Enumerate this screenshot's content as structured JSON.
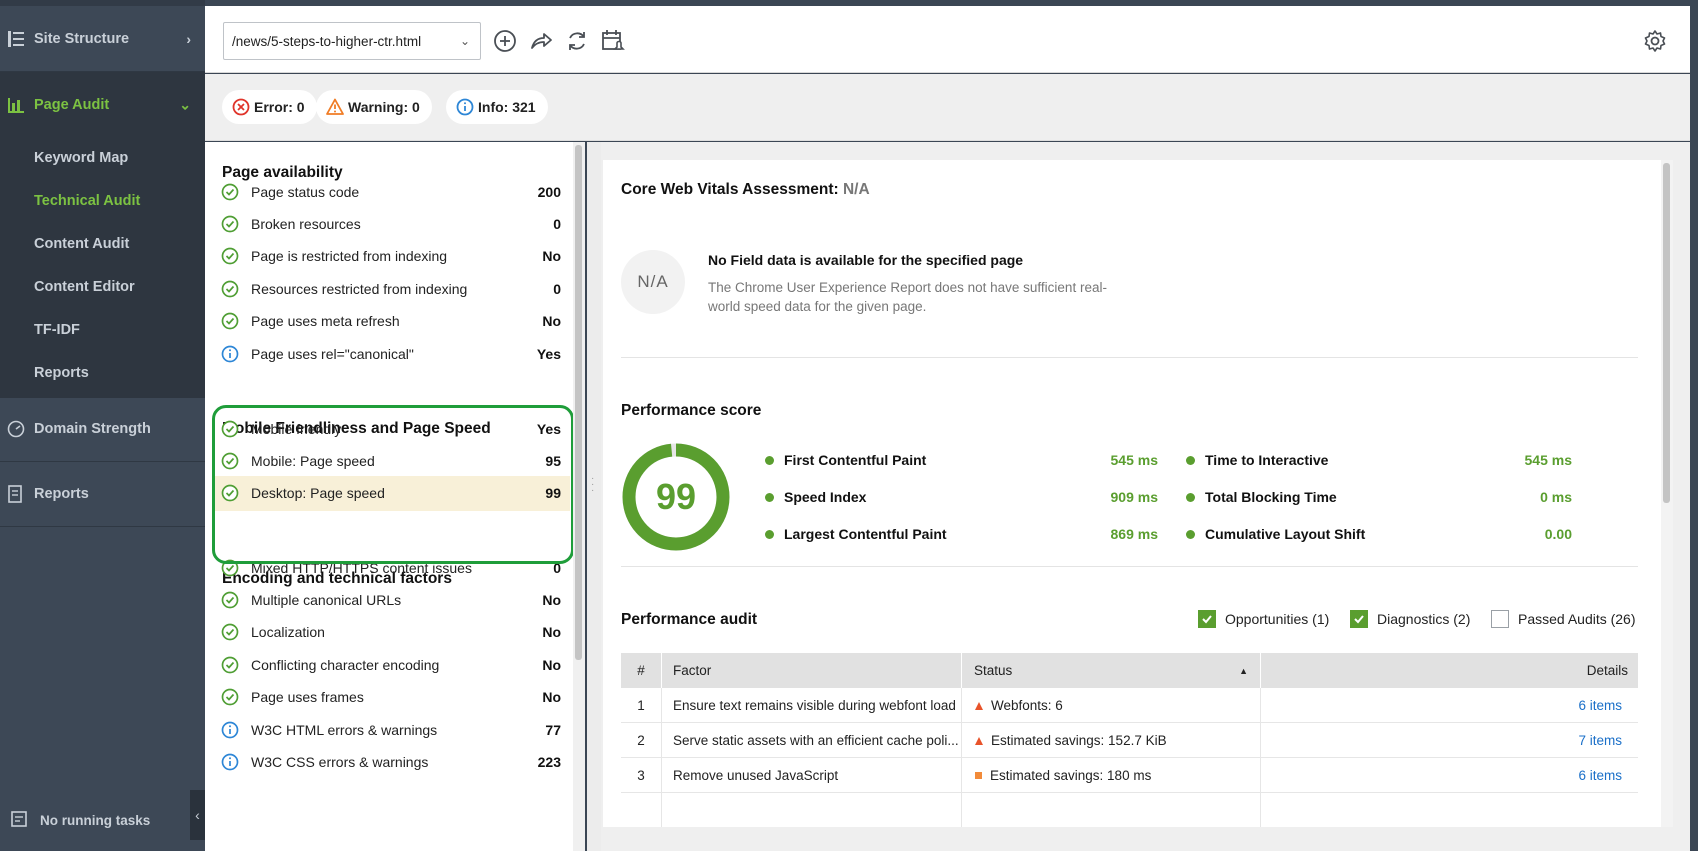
{
  "sidebar": {
    "site_structure": "Site Structure",
    "page_audit": "Page Audit",
    "sub_items": [
      "Keyword Map",
      "Technical Audit",
      "Content Audit",
      "Content Editor",
      "TF-IDF",
      "Reports"
    ],
    "domain_strength": "Domain Strength",
    "reports": "Reports",
    "tasks": "No running tasks",
    "accent_color": "#7cc242"
  },
  "toolbar": {
    "url": "/news/5-steps-to-higher-ctr.html",
    "icons": [
      "add-circle-icon",
      "share-icon",
      "refresh-icon",
      "schedule-icon",
      "gear-icon"
    ]
  },
  "status": {
    "error": "Error: 0",
    "warning": "Warning: 0",
    "info": "Info: 321"
  },
  "left": {
    "availability_title": "Page availability",
    "availability": [
      {
        "label": "Page status code",
        "value": "200",
        "status": "ok"
      },
      {
        "label": "Broken resources",
        "value": "0",
        "status": "ok"
      },
      {
        "label": "Page is restricted from indexing",
        "value": "No",
        "status": "ok"
      },
      {
        "label": "Resources restricted from indexing",
        "value": "0",
        "status": "ok"
      },
      {
        "label": "Page uses meta refresh",
        "value": "No",
        "status": "ok"
      },
      {
        "label": "Page uses rel=\"canonical\"",
        "value": "Yes",
        "status": "info"
      }
    ],
    "mobile_title": "Mobile Friendliness and Page Speed",
    "mobile": [
      {
        "label": "Mobile friendly",
        "value": "Yes",
        "status": "ok"
      },
      {
        "label": "Mobile: Page speed",
        "value": "95",
        "status": "ok"
      },
      {
        "label": "Desktop: Page speed",
        "value": "99",
        "status": "ok"
      }
    ],
    "encoding_title": "Encoding and technical factors",
    "encoding": [
      {
        "label": "Mixed HTTP/HTTPS content issues",
        "value": "0",
        "status": "ok"
      },
      {
        "label": "Multiple canonical URLs",
        "value": "No",
        "status": "ok"
      },
      {
        "label": "Localization",
        "value": "No",
        "status": "ok"
      },
      {
        "label": "Conflicting character encoding",
        "value": "No",
        "status": "ok"
      },
      {
        "label": "Page uses frames",
        "value": "No",
        "status": "ok"
      },
      {
        "label": "W3C HTML errors & warnings",
        "value": "77",
        "status": "info"
      },
      {
        "label": "W3C CSS errors & warnings",
        "value": "223",
        "status": "info"
      }
    ]
  },
  "cwv": {
    "title": "Core Web Vitals Assessment:",
    "status": "N/A",
    "circle": "N/A",
    "nofield_title": "No Field data is available for the specified page",
    "nofield_desc": "The Chrome User Experience Report does not have sufficient real-world speed data for the given page."
  },
  "performance": {
    "title": "Performance score",
    "score": "99",
    "score_value": 99,
    "score_color": "#5a9e2f",
    "metrics": [
      {
        "label": "First Contentful Paint",
        "value": "545 ms"
      },
      {
        "label": "Speed Index",
        "value": "909 ms"
      },
      {
        "label": "Largest Contentful Paint",
        "value": "869 ms"
      },
      {
        "label": "Time to Interactive",
        "value": "545 ms"
      },
      {
        "label": "Total Blocking Time",
        "value": "0 ms"
      },
      {
        "label": "Cumulative Layout Shift",
        "value": "0.00"
      }
    ]
  },
  "audit": {
    "title": "Performance audit",
    "filters": [
      {
        "label": "Opportunities (1)",
        "checked": true
      },
      {
        "label": "Diagnostics (2)",
        "checked": true
      },
      {
        "label": "Passed Audits (26)",
        "checked": false
      }
    ],
    "columns": [
      "#",
      "Factor",
      "Status",
      "Details"
    ],
    "rows": [
      {
        "n": "1",
        "factor": "Ensure text remains visible during webfont load",
        "status": "Webfonts: 6",
        "marker": "triangle",
        "details": "6 items"
      },
      {
        "n": "2",
        "factor": "Serve static assets with an efficient cache poli...",
        "status": "Estimated savings: 152.7 KiB",
        "marker": "triangle",
        "details": "7 items"
      },
      {
        "n": "3",
        "factor": "Remove unused JavaScript",
        "status": "Estimated savings: 180 ms",
        "marker": "square",
        "details": "6 items"
      }
    ]
  }
}
